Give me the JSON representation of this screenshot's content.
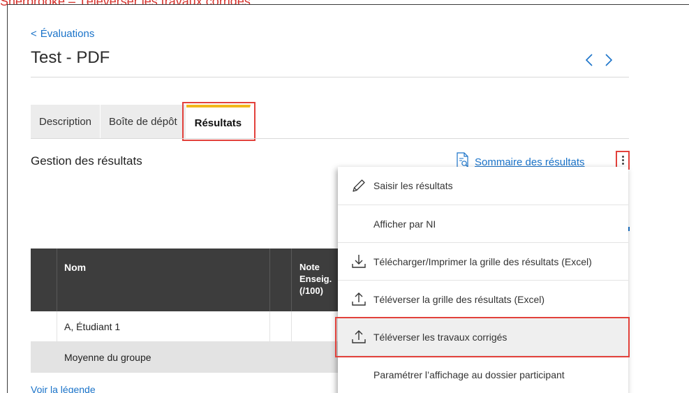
{
  "caption": "Sherbrooke – Téléverser les travaux corrigés",
  "breadcrumb": {
    "back_label": "Évaluations"
  },
  "page": {
    "title": "Test - PDF"
  },
  "tabs": [
    {
      "label": "Description",
      "active": false
    },
    {
      "label": "Boîte de dépôt",
      "active": false
    },
    {
      "label": "Résultats",
      "active": true
    }
  ],
  "section": {
    "title": "Gestion des résultats",
    "summary_link": "Sommaire des résultats"
  },
  "table": {
    "headers": {
      "name": "Nom",
      "note": "Note Enseig. (/100)"
    },
    "rows": [
      {
        "name": "A, Étudiant 1"
      }
    ],
    "average_label": "Moyenne du groupe"
  },
  "legend_link": "Voir la légende",
  "menu": {
    "items": [
      {
        "label": "Saisir les résultats",
        "icon": "pencil-icon",
        "selected": false
      },
      {
        "label": "Afficher par NI",
        "icon": "",
        "selected": false
      },
      {
        "label": "Télécharger/Imprimer la grille des résultats (Excel)",
        "icon": "download-icon",
        "selected": false
      },
      {
        "label": "Téléverser la grille des résultats (Excel)",
        "icon": "upload-icon",
        "selected": false
      },
      {
        "label": "Téléverser les travaux corrigés",
        "icon": "upload-icon",
        "selected": true
      },
      {
        "label": "Paramétrer l’affichage au dossier participant",
        "icon": "",
        "selected": false
      }
    ]
  },
  "colors": {
    "link": "#1a73c9",
    "highlight": "#e2413b",
    "active_tab_accent": "#f2b81c",
    "table_header": "#3d3d3d"
  }
}
